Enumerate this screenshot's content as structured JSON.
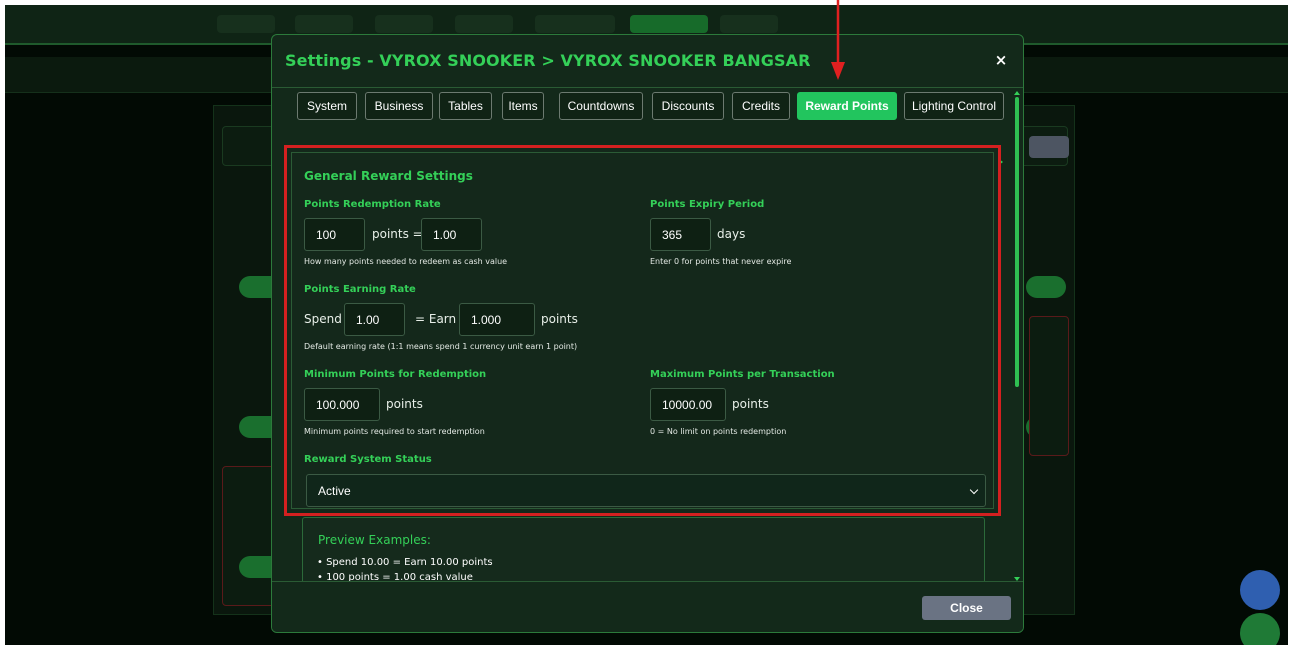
{
  "modal": {
    "title": "Settings - VYROX SNOOKER > VYROX SNOOKER BANGSAR",
    "close_icon": "×",
    "tabs": [
      {
        "label": "System",
        "active": false
      },
      {
        "label": "Business",
        "active": false
      },
      {
        "label": "Tables",
        "active": false
      },
      {
        "label": "Items",
        "active": false
      },
      {
        "label": "Countdowns",
        "active": false
      },
      {
        "label": "Discounts",
        "active": false
      },
      {
        "label": "Credits",
        "active": false
      },
      {
        "label": "Reward Points",
        "active": true
      },
      {
        "label": "Lighting Control",
        "active": false
      }
    ],
    "close_button": "Close"
  },
  "general": {
    "section_title": "General Reward Settings",
    "redemption_rate": {
      "label": "Points Redemption Rate",
      "points_value": "100",
      "equals_text": "points =",
      "cash_value": "1.00",
      "hint": "How many points needed to redeem as cash value"
    },
    "expiry": {
      "label": "Points Expiry Period",
      "value": "365",
      "unit": "days",
      "hint": "Enter 0 for points that never expire"
    },
    "earning_rate": {
      "label": "Points Earning Rate",
      "spend_text": "Spend",
      "spend_value": "1.00",
      "earn_text": "= Earn",
      "earn_value": "1.000",
      "unit": "points",
      "hint": "Default earning rate (1:1 means spend 1 currency unit earn 1 point)"
    },
    "min_points": {
      "label": "Minimum Points for Redemption",
      "value": "100.000",
      "unit": "points",
      "hint": "Minimum points required to start redemption"
    },
    "max_points": {
      "label": "Maximum Points per Transaction",
      "value": "10000.00",
      "unit": "points",
      "hint": "0 = No limit on points redemption"
    },
    "status": {
      "label": "Reward System Status",
      "selected": "Active"
    }
  },
  "preview": {
    "title": "Preview Examples:",
    "lines": [
      "• Spend 10.00 = Earn 10.00 points",
      "• 100 points = 1.00 cash value"
    ]
  },
  "colors": {
    "accent": "#34d058",
    "active_tab": "#22c55e",
    "highlight_border": "#d42020",
    "modal_bg": "#13291a",
    "close_button": "#6a7383"
  },
  "icons": {
    "close": "close-icon",
    "select_chevron": "chevron-down-icon",
    "annotation": "red-arrow-icon"
  }
}
